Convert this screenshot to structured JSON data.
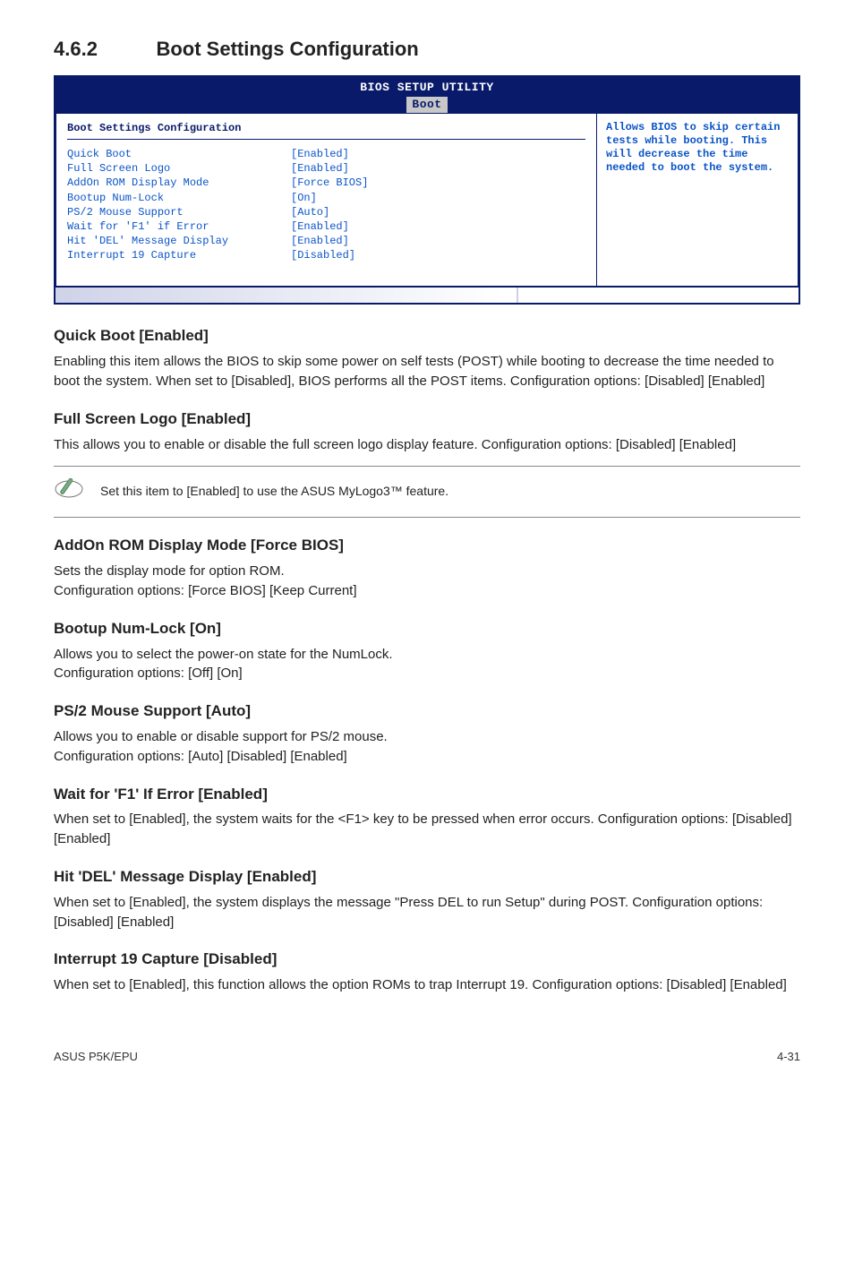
{
  "section": {
    "number": "4.6.2",
    "title": "Boot Settings Configuration"
  },
  "bios": {
    "header": "BIOS SETUP UTILITY",
    "tab": "Boot",
    "panel_title": "Boot Settings Configuration",
    "rows": [
      {
        "label": "Quick Boot",
        "value": "[Enabled]"
      },
      {
        "label": "Full Screen Logo",
        "value": "[Enabled]"
      },
      {
        "label": "AddOn ROM Display Mode",
        "value": "[Force BIOS]"
      },
      {
        "label": "Bootup Num-Lock",
        "value": "[On]"
      },
      {
        "label": "PS/2 Mouse Support",
        "value": "[Auto]"
      },
      {
        "label": "Wait for 'F1' if Error",
        "value": "[Enabled]"
      },
      {
        "label": "Hit 'DEL' Message Display",
        "value": "[Enabled]"
      },
      {
        "label": "Interrupt 19 Capture",
        "value": "[Disabled]"
      }
    ],
    "help": "Allows BIOS to skip certain tests while booting. This will decrease the time needed to boot the system."
  },
  "items": [
    {
      "heading": "Quick Boot [Enabled]",
      "body": "Enabling this item allows the BIOS to skip some power on self tests (POST) while booting to decrease the time needed to boot the system. When set to [Disabled], BIOS performs all the POST items. Configuration options: [Disabled] [Enabled]"
    },
    {
      "heading": "Full Screen Logo [Enabled]",
      "body": "This allows you to enable or disable the full screen logo display feature. Configuration options: [Disabled] [Enabled]"
    }
  ],
  "note": "Set this item to [Enabled] to use the ASUS MyLogo3™ feature.",
  "items2": [
    {
      "heading": "AddOn ROM Display Mode [Force BIOS]",
      "body": "Sets the display mode for option ROM.\nConfiguration options: [Force BIOS] [Keep Current]"
    },
    {
      "heading": "Bootup Num-Lock [On]",
      "body": "Allows you to select the power-on state for the NumLock.\nConfiguration options: [Off] [On]"
    },
    {
      "heading": "PS/2 Mouse Support [Auto]",
      "body": "Allows you to enable or disable support for PS/2 mouse.\nConfiguration options: [Auto] [Disabled] [Enabled]"
    },
    {
      "heading": "Wait for 'F1' If Error [Enabled]",
      "body": "When set to [Enabled], the system waits for the <F1> key to be pressed when error occurs. Configuration options: [Disabled] [Enabled]"
    },
    {
      "heading": "Hit 'DEL' Message Display [Enabled]",
      "body": "When set to [Enabled], the system displays the message \"Press DEL to run Setup\" during POST. Configuration options: [Disabled] [Enabled]"
    },
    {
      "heading": "Interrupt 19 Capture [Disabled]",
      "body": "When set to [Enabled], this function allows the option ROMs to trap Interrupt 19. Configuration options: [Disabled] [Enabled]"
    }
  ],
  "footer": {
    "left": "ASUS P5K/EPU",
    "right": "4-31"
  }
}
